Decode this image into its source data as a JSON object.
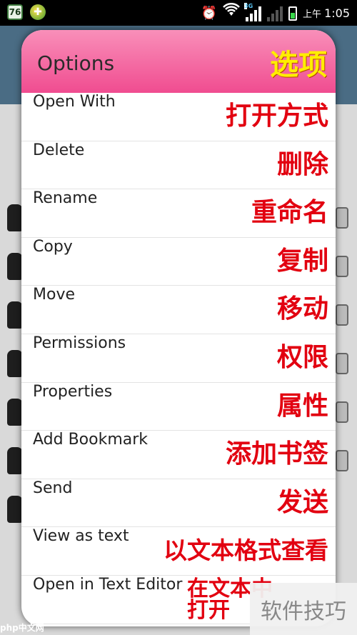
{
  "status_bar": {
    "notification_badge": "76",
    "ampm": "上午",
    "time": "1:05",
    "network_tag": "3G"
  },
  "dialog": {
    "title": "Options",
    "title_cn": "选项",
    "items": [
      {
        "label": "Open With",
        "cn": "打开方式"
      },
      {
        "label": "Delete",
        "cn": "删除"
      },
      {
        "label": "Rename",
        "cn": "重命名"
      },
      {
        "label": "Copy",
        "cn": "复制"
      },
      {
        "label": "Move",
        "cn": "移动"
      },
      {
        "label": "Permissions",
        "cn": "权限"
      },
      {
        "label": "Properties",
        "cn": "属性"
      },
      {
        "label": "Add Bookmark",
        "cn": "添加书签"
      },
      {
        "label": "Send",
        "cn": "发送"
      },
      {
        "label": "View as text",
        "cn": "以文本格式查看"
      },
      {
        "label": "Open in Text Editor",
        "cn": "在文本中打开"
      }
    ]
  },
  "watermark": {
    "site": "php中文网",
    "badge": "软件技巧"
  },
  "colors": {
    "header_top": "#f98fb9",
    "header_bottom": "#f04c90",
    "title_cn": "#ffee00",
    "annotation": "#e20010"
  }
}
